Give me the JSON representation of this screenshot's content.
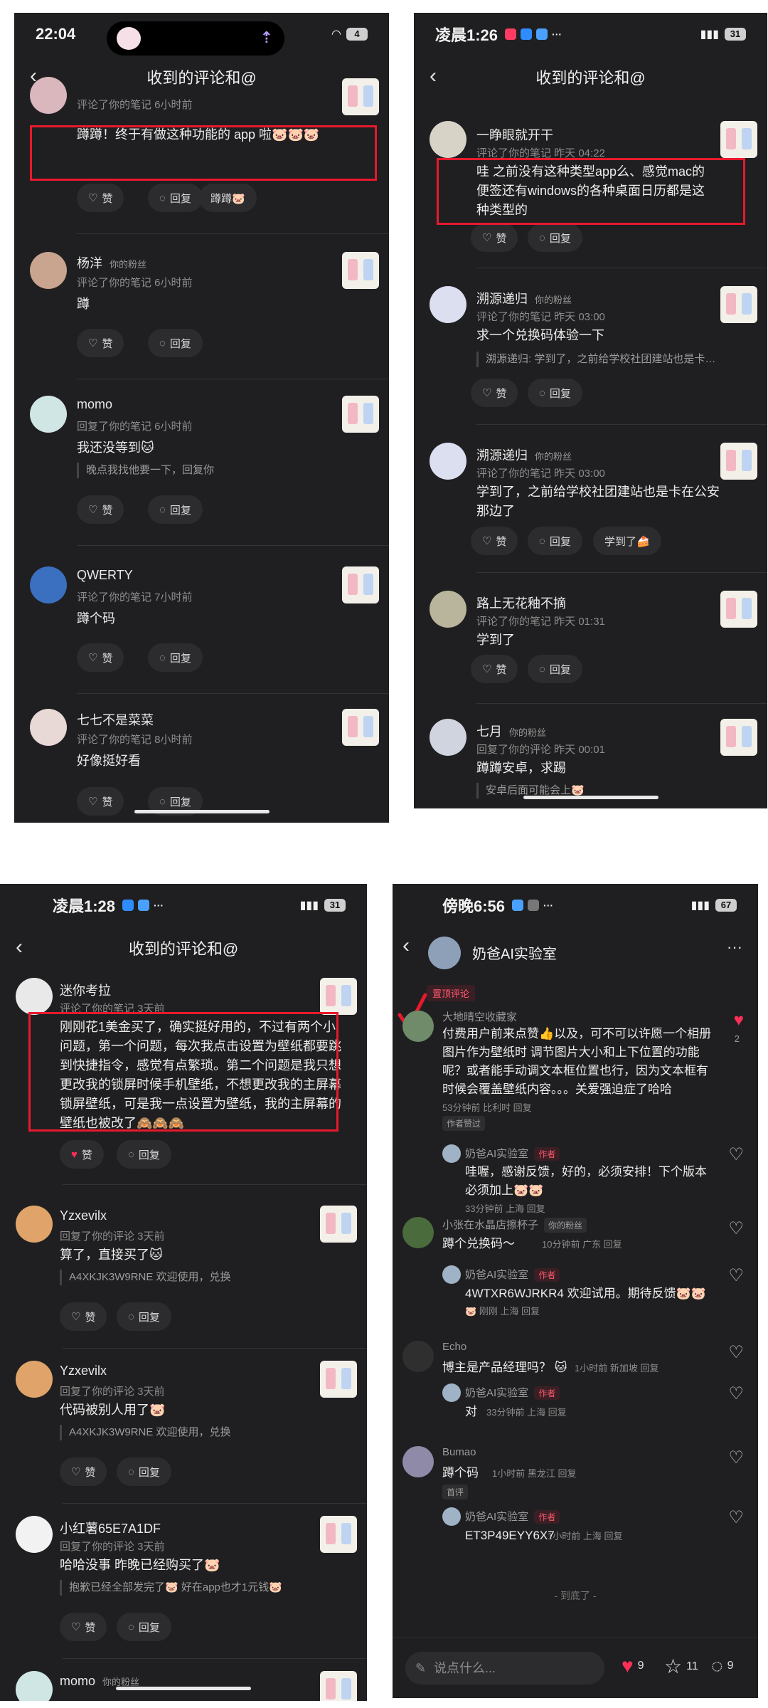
{
  "p1": {
    "time": "22:04",
    "battery": "4",
    "title": "收到的评论和@",
    "comments": [
      {
        "user": "",
        "fans": "",
        "meta": "评论了你的笔记  6小时前",
        "text": "蹲蹲！终于有做这种功能的 app 啦🐷🐷🐷",
        "quote": "",
        "like": "赞",
        "reply": "回复",
        "extra": "蹲蹲🐷"
      },
      {
        "user": "杨洋",
        "fans": "你的粉丝",
        "meta": "评论了你的笔记  6小时前",
        "text": "蹲",
        "quote": "",
        "like": "赞",
        "reply": "回复",
        "extra": ""
      },
      {
        "user": "momo",
        "fans": "",
        "meta": "回复了你的笔记  6小时前",
        "text": "我还没等到🐱",
        "quote": "晚点我找他要一下，回复你",
        "like": "赞",
        "reply": "回复",
        "extra": ""
      },
      {
        "user": "QWERTY",
        "fans": "",
        "meta": "评论了你的笔记  7小时前",
        "text": "蹲个码",
        "quote": "",
        "like": "赞",
        "reply": "回复",
        "extra": ""
      },
      {
        "user": "七七不是菜菜",
        "fans": "",
        "meta": "评论了你的笔记  8小时前",
        "text": "好像挺好看",
        "quote": "",
        "like": "赞",
        "reply": "回复",
        "extra": ""
      }
    ]
  },
  "p2": {
    "time": "凌晨1:26",
    "battery": "31",
    "title": "收到的评论和@",
    "comments": [
      {
        "user": "一睁眼就开干",
        "fans": "",
        "meta": "评论了你的笔记  昨天 04:22",
        "text": "哇 之前没有这种类型app么、感觉mac的便签还有windows的各种桌面日历都是这种类型的",
        "quote": "",
        "like": "赞",
        "reply": "回复",
        "extra": ""
      },
      {
        "user": "溯源递归",
        "fans": "你的粉丝",
        "meta": "评论了你的笔记  昨天 03:00",
        "text": "求一个兑换码体验一下",
        "quote": "溯源递归: 学到了，之前给学校社团建站也是卡…",
        "like": "赞",
        "reply": "回复",
        "extra": ""
      },
      {
        "user": "溯源递归",
        "fans": "你的粉丝",
        "meta": "评论了你的笔记  昨天 03:00",
        "text": "学到了，之前给学校社团建站也是卡在公安那边了",
        "quote": "",
        "like": "赞",
        "reply": "回复",
        "extra": "学到了🍰"
      },
      {
        "user": "路上无花釉不摘",
        "fans": "",
        "meta": "评论了你的笔记  昨天 01:31",
        "text": "学到了",
        "quote": "",
        "like": "赞",
        "reply": "回复",
        "extra": ""
      },
      {
        "user": "七月",
        "fans": "你的粉丝",
        "meta": "回复了你的评论  昨天 00:01",
        "text": "蹲蹲安卓，求踢",
        "quote": "安卓后面可能会上🐷",
        "like": "",
        "reply": "",
        "extra": ""
      }
    ]
  },
  "p3": {
    "time": "凌晨1:28",
    "battery": "31",
    "title": "收到的评论和@",
    "comments": [
      {
        "user": "迷你考拉",
        "fans": "",
        "meta": "评论了你的笔记  3天前",
        "text": "刚刚花1美金买了，确实挺好用的，不过有两个小问题，第一个问题，每次我点击设置为壁纸都要跳到快捷指令，感觉有点繁琐。第二个问题是我只想更改我的锁屏时候手机壁纸，不想更改我的主屏幕锁屏壁纸，可是我一点设置为壁纸，我的主屏幕的壁纸也被改了🙈🙈🙈",
        "quote": "",
        "like": "赞",
        "reply": "回复",
        "extra": ""
      },
      {
        "user": "Yzxevilx",
        "fans": "",
        "meta": "回复了你的评论  3天前",
        "text": "算了，直接买了🐱",
        "quote": "A4XKJK3W9RNE 欢迎使用，兑换",
        "like": "赞",
        "reply": "回复",
        "extra": ""
      },
      {
        "user": "Yzxevilx",
        "fans": "",
        "meta": "回复了你的评论  3天前",
        "text": "代码被别人用了🐷",
        "quote": "A4XKJK3W9RNE 欢迎使用，兑换",
        "like": "赞",
        "reply": "回复",
        "extra": ""
      },
      {
        "user": "小红薯65E7A1DF",
        "fans": "",
        "meta": "回复了你的评论  3天前",
        "text": "哈哈没事 昨晚已经购买了🐷",
        "quote": "抱歉已经全部发完了🐷 好在app也才1元钱🐷",
        "like": "赞",
        "reply": "回复",
        "extra": ""
      },
      {
        "user": "momo",
        "fans": "你的粉丝",
        "meta": "",
        "text": "",
        "quote": "",
        "like": "",
        "reply": "",
        "extra": ""
      }
    ]
  },
  "p4": {
    "time": "傍晚6:56",
    "battery": "67",
    "title": "奶爸AI实验室",
    "pinned": "置顶评论",
    "author_tag": "作者",
    "end_text": "- 到底了 -",
    "input_placeholder": "说点什么...",
    "likes": "9",
    "stars": "11",
    "comments_count": "9",
    "threads": [
      {
        "user": "大地晴空收藏家",
        "text": "付费用户前来点赞👍以及，可不可以许愿一个相册图片作为壁纸时 调节图片大小和上下位置的功能呢？或者能手动调文本框位置也行，因为文本框有时候会覆盖壁纸内容。。。关爱强迫症了哈哈",
        "meta": "53分钟前  比利时  回复",
        "badge": "作者赞过",
        "like_count": "2",
        "reply": {
          "user": "奶爸AI实验室",
          "text": "哇喔，感谢反馈，好的，必须安排！下个版本必须加上🐷🐷",
          "meta": "33分钟前  上海  回复"
        }
      },
      {
        "user": "小张在水晶店擦杯子",
        "fans": "你的粉丝",
        "text": "蹲个兑换码～",
        "meta": "10分钟前  广东  回复",
        "badge": "",
        "reply": {
          "user": "奶爸AI实验室",
          "text": "4WTXR6WJRKR4 欢迎试用。期待反馈🐷🐷",
          "meta": "🐷  刚刚  上海  回复"
        }
      },
      {
        "user": "Echo",
        "text": "博主是产品经理吗？ 🐱",
        "meta": "1小时前  新加坡  回复",
        "badge": "",
        "reply": {
          "user": "奶爸AI实验室",
          "text": "对",
          "meta": "33分钟前  上海  回复"
        }
      },
      {
        "user": "Bumao",
        "text": "蹲个码",
        "meta": "1小时前  黑龙江  回复",
        "badge": "首评",
        "reply": {
          "user": "奶爸AI实验室",
          "text": "ET3P49EYY6X7",
          "meta": "1小时前  上海  回复"
        }
      }
    ]
  },
  "colors": {
    "accent": "#ff2f57",
    "redbox": "#e8192c",
    "bg": "#1f1f21"
  }
}
